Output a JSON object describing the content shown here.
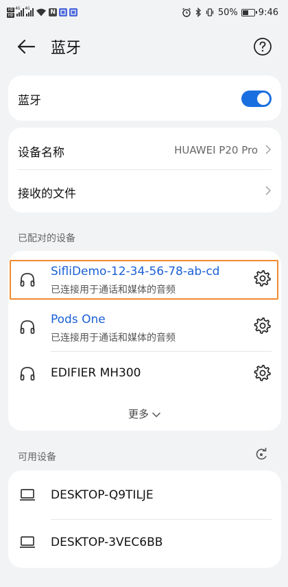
{
  "status_bar": {
    "hd1": "HD",
    "hd2": "HD",
    "sig1_label": "4G",
    "sig2_label": "4G",
    "battery": "50%",
    "time": "9:46",
    "nfc_letter": "N"
  },
  "header": {
    "title": "蓝牙"
  },
  "bluetooth_card": {
    "label": "蓝牙",
    "enabled": true,
    "accent_color": "#1a6fe0"
  },
  "info_card": {
    "device_name_label": "设备名称",
    "device_name_value": "HUAWEI P20 Pro",
    "received_files_label": "接收的文件"
  },
  "paired_section": {
    "label": "已配对的设备",
    "devices": [
      {
        "name": "SifliDemo-12-34-56-78-ab-cd",
        "status": "已连接用于通话和媒体的音频",
        "connected": true,
        "icon": "headphones-icon"
      },
      {
        "name": "Pods One",
        "status": "已连接用于通话和媒体的音频",
        "connected": true,
        "icon": "headphones-icon"
      },
      {
        "name": "EDIFIER MH300",
        "status": "",
        "connected": false,
        "icon": "headphones-icon"
      }
    ],
    "more_label": "更多"
  },
  "available_section": {
    "label": "可用设备",
    "devices": [
      {
        "name": "DESKTOP-Q9TILJE",
        "icon": "laptop-icon"
      },
      {
        "name": "DESKTOP-3VEC6BB",
        "icon": "laptop-icon"
      }
    ]
  },
  "highlight_color": "#f08a2e"
}
